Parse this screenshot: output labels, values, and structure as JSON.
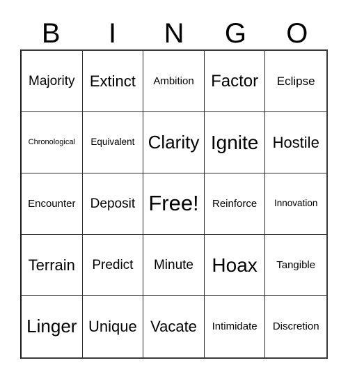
{
  "card": {
    "title": "BINGO",
    "header_letters": [
      "B",
      "I",
      "N",
      "G",
      "O"
    ],
    "free_space_label": "Free!",
    "colors": {
      "background": "#ffffff",
      "text": "#000000",
      "grid_line": "#2b2b2b",
      "border": "#1a1a1a"
    },
    "grid": {
      "columns": 5,
      "rows": 5,
      "rows_data": [
        [
          {
            "label": "Majority",
            "size": "fs-ml"
          },
          {
            "label": "Extinct",
            "size": "fs-l"
          },
          {
            "label": "Ambition",
            "size": "fs-s"
          },
          {
            "label": "Factor",
            "size": "fs-xl"
          },
          {
            "label": "Eclipse",
            "size": "fs-m"
          }
        ],
        [
          {
            "label": "Chronological",
            "size": "fs-xxs"
          },
          {
            "label": "Equivalent",
            "size": "fs-xs"
          },
          {
            "label": "Clarity",
            "size": "fs-xxl"
          },
          {
            "label": "Ignite",
            "size": "fs-h"
          },
          {
            "label": "Hostile",
            "size": "fs-l"
          }
        ],
        [
          {
            "label": "Encounter",
            "size": "fs-s"
          },
          {
            "label": "Deposit",
            "size": "fs-ml"
          },
          {
            "label": "Free!",
            "size": "fs-free"
          },
          {
            "label": "Reinforce",
            "size": "fs-s"
          },
          {
            "label": "Innovation",
            "size": "fs-xs"
          }
        ],
        [
          {
            "label": "Terrain",
            "size": "fs-l"
          },
          {
            "label": "Predict",
            "size": "fs-ml"
          },
          {
            "label": "Minute",
            "size": "fs-ml"
          },
          {
            "label": "Hoax",
            "size": "fs-h"
          },
          {
            "label": "Tangible",
            "size": "fs-s"
          }
        ],
        [
          {
            "label": "Linger",
            "size": "fs-xxl"
          },
          {
            "label": "Unique",
            "size": "fs-l"
          },
          {
            "label": "Vacate",
            "size": "fs-l"
          },
          {
            "label": "Intimidate",
            "size": "fs-s"
          },
          {
            "label": "Discretion",
            "size": "fs-s"
          }
        ]
      ]
    }
  }
}
